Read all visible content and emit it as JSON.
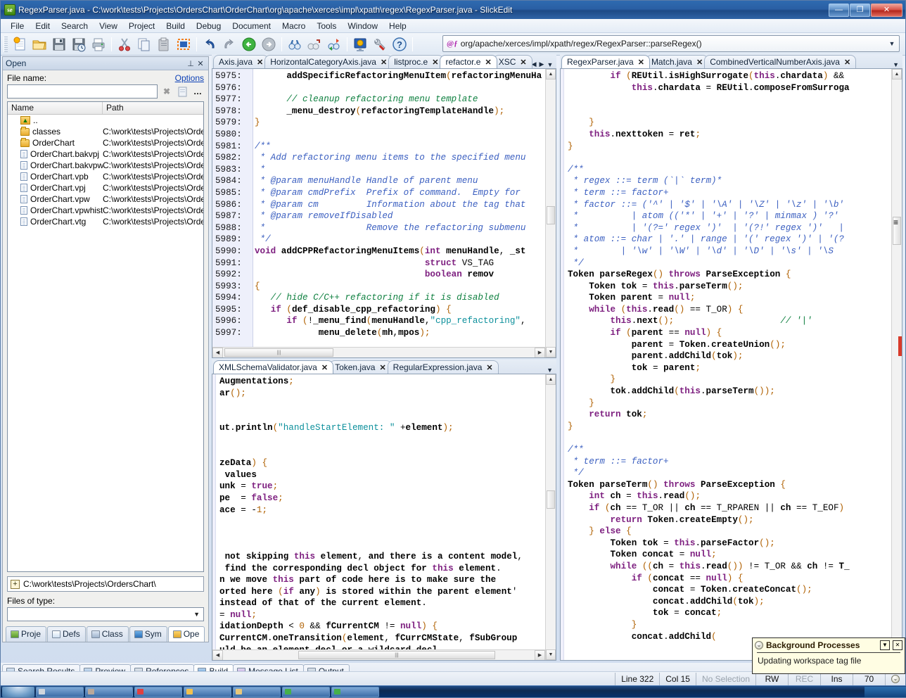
{
  "window": {
    "title": "RegexParser.java - C:\\work\\tests\\Projects\\OrdersChart\\OrderChart\\org\\apache\\xerces\\impl\\xpath\\regex\\RegexParser.java - SlickEdit",
    "app_icon": "se",
    "minimize": "—",
    "maximize": "❐",
    "close": "✕"
  },
  "menu": {
    "items": [
      "File",
      "Edit",
      "Search",
      "View",
      "Project",
      "Build",
      "Debug",
      "Document",
      "Macro",
      "Tools",
      "Window",
      "Help"
    ]
  },
  "toolbar": {
    "icons": [
      {
        "name": "new-file-icon",
        "glyph": "📄"
      },
      {
        "name": "open-folder-icon",
        "glyph": "📂"
      },
      {
        "name": "save-icon",
        "glyph": "💾"
      },
      {
        "name": "save-as-icon",
        "glyph": "💾"
      },
      {
        "name": "print-icon",
        "glyph": "🖨"
      },
      {
        "name": "cut-icon",
        "glyph": "✂"
      },
      {
        "name": "copy-icon",
        "glyph": "⧉"
      },
      {
        "name": "paste-icon",
        "glyph": "📋"
      },
      {
        "name": "select-block-icon",
        "glyph": "▣"
      },
      {
        "name": "undo-icon",
        "glyph": "↶"
      },
      {
        "name": "redo-icon",
        "glyph": "↷"
      },
      {
        "name": "back-icon",
        "glyph": "←"
      },
      {
        "name": "forward-icon",
        "glyph": "→"
      },
      {
        "name": "find-icon",
        "glyph": "👓"
      },
      {
        "name": "find-next-icon",
        "glyph": "👓"
      },
      {
        "name": "replace-icon",
        "glyph": "👓"
      },
      {
        "name": "configuration-icon",
        "glyph": "🖥"
      },
      {
        "name": "options-wrench-icon",
        "glyph": "🔧"
      },
      {
        "name": "help-icon",
        "glyph": "?"
      }
    ]
  },
  "address_bar": {
    "icon": "function-icon",
    "icon_glyph": "@ƒ",
    "value": "org/apache/xerces/impl/xpath/regex/RegexParser::parseRegex()",
    "dropdown_glyph": "▼"
  },
  "open_panel": {
    "title": "Open",
    "pin_glyph": "⊥",
    "close_glyph": "✕",
    "file_name_label": "File name:",
    "options_link": "Options",
    "file_name_value": "",
    "clear_glyph": "✖",
    "newfile_glyph": "🗋",
    "more_glyph": "…",
    "columns": [
      "Name",
      "Path"
    ],
    "rows": [
      {
        "icon": "up-folder-icon",
        "name": "..",
        "path": ""
      },
      {
        "icon": "folder-icon",
        "name": "classes",
        "path": "C:\\work\\tests\\Projects\\OrdersC"
      },
      {
        "icon": "folder-icon",
        "name": "OrderChart",
        "path": "C:\\work\\tests\\Projects\\OrdersC"
      },
      {
        "icon": "file-icon",
        "name": "OrderChart.bakvpj",
        "path": "C:\\work\\tests\\Projects\\OrdersC"
      },
      {
        "icon": "file-icon",
        "name": "OrderChart.bakvpw",
        "path": "C:\\work\\tests\\Projects\\OrdersC"
      },
      {
        "icon": "file-icon",
        "name": "OrderChart.vpb",
        "path": "C:\\work\\tests\\Projects\\OrdersC"
      },
      {
        "icon": "file-icon",
        "name": "OrderChart.vpj",
        "path": "C:\\work\\tests\\Projects\\OrdersC"
      },
      {
        "icon": "file-icon",
        "name": "OrderChart.vpw",
        "path": "C:\\work\\tests\\Projects\\OrdersC"
      },
      {
        "icon": "file-icon",
        "name": "OrderChart.vpwhist",
        "path": "C:\\work\\tests\\Projects\\OrdersC"
      },
      {
        "icon": "file-icon",
        "name": "OrderChart.vtg",
        "path": "C:\\work\\tests\\Projects\\OrdersC"
      }
    ],
    "path_value": "C:\\work\\tests\\Projects\\OrdersChart\\",
    "path_expand_glyph": "+",
    "files_of_type_label": "Files of type:",
    "files_of_type_value": "",
    "dropdown_glyph": "▼",
    "tabs": [
      {
        "label": "Proje",
        "icon": "projects-icon",
        "active": false
      },
      {
        "label": "Defs",
        "icon": "defs-icon",
        "active": false
      },
      {
        "label": "Class",
        "icon": "class-icon",
        "active": false
      },
      {
        "label": "Sym",
        "icon": "symbols-icon",
        "active": false
      },
      {
        "label": "Ope",
        "icon": "open-icon",
        "active": true
      }
    ]
  },
  "center_top_editor": {
    "tabs": [
      {
        "label": "Axis.java",
        "active": false
      },
      {
        "label": "HorizontalCategoryAxis.java",
        "active": false
      },
      {
        "label": "listproc.e",
        "active": false
      },
      {
        "label": "refactor.e",
        "active": true
      },
      {
        "label": "XSC",
        "active": false
      }
    ],
    "nav_prev": "◀",
    "nav_next": "▶",
    "nav_list": "▼",
    "first_line_number": 5975,
    "lines": [
      "5975:",
      "5976:",
      "5977:",
      "5978:",
      "5979:",
      "5980:",
      "5981:",
      "5982:",
      "5983:",
      "5984:",
      "5985:",
      "5986:",
      "5987:",
      "5988:",
      "5989:",
      "5990:",
      "5991:",
      "5992:",
      "5993:",
      "5994:",
      "5995:",
      "5996:",
      "5997:"
    ],
    "code_text": [
      "      addSpecificRefactoringMenuItem(refactoringMenuHa",
      "",
      "      // cleanup refactoring menu template",
      "      _menu_destroy(refactoringTemplateHandle);",
      "}",
      "",
      "/**",
      " * Add refactoring menu items to the specified menu",
      " *",
      " * @param menuHandle Handle of parent menu",
      " * @param cmdPrefix  Prefix of command.  Empty for ",
      " * @param cm         Information about the tag that",
      " * @param removeIfDisabled",
      " *                   Remove the refactoring submenu",
      " */",
      "void addCPPRefactoringMenuItems(int menuHandle, _st",
      "                                struct VS_TAG",
      "                                boolean remov",
      "{",
      "   // hide C/C++ refactoring if it is disabled",
      "   if (def_disable_cpp_refactoring) {",
      "      if (!_menu_find(menuHandle,\"cpp_refactoring\",",
      "            menu_delete(mh,mpos);"
    ]
  },
  "center_bottom_editor": {
    "tabs": [
      {
        "label": "XMLSchemaValidator.java",
        "active": true
      },
      {
        "label": "Token.java",
        "active": false
      },
      {
        "label": "RegularExpression.java",
        "active": false
      }
    ],
    "nav_list": "▼",
    "code_text": [
      "Augmentations;",
      "ar();",
      "",
      "",
      "ut.println(\"handleStartElement: \" +element);",
      "",
      "",
      "zeData) {",
      " values",
      "unk = true;",
      "pe  = false;",
      "ace = -1;",
      "",
      "",
      "",
      " not skipping this element, and there is a content model,",
      " find the corresponding decl object for this element.",
      "n we move this part of code here is to make sure the",
      "orted here (if any) is stored within the parent element'",
      "instead of that of the current element.",
      "= null;",
      "idationDepth < 0 && fCurrentCM != null) {",
      "CurrentCM.oneTransition(element, fCurrCMState, fSubGroup",
      "uld be an element decl or a wildcard decl"
    ]
  },
  "right_editor": {
    "tabs": [
      {
        "label": "RegexParser.java",
        "active": true
      },
      {
        "label": "Match.java",
        "active": false
      },
      {
        "label": "CombinedVerticalNumberAxis.java",
        "active": false
      }
    ],
    "nav_list": "▼",
    "code_text": [
      "        if (REUtil.isHighSurrogate(this.chardata) &&",
      "            this.chardata = REUtil.composeFromSurroga",
      "",
      "",
      "    }",
      "    this.nexttoken = ret;",
      "}",
      "",
      "/**",
      " * regex ::= term (`|` term)*",
      " * term ::= factor+",
      " * factor ::= ('^' | '$' | '\\A' | '\\Z' | '\\z' | '\\b'",
      " *          | atom (('*' | '+' | '?' | minmax ) '?'",
      " *          | '(?=' regex ')'  | '(?!' regex ')'   |",
      " * atom ::= char | '.' | range | '(' regex ')' | '(?",
      " *        | '\\w' | '\\W' | '\\d' | '\\D' | '\\s' | '\\S",
      " */",
      "Token parseRegex() throws ParseException {",
      "    Token tok = this.parseTerm();",
      "    Token parent = null;",
      "    while (this.read() == T_OR) {",
      "        this.next();                    // '|'",
      "        if (parent == null) {",
      "            parent = Token.createUnion();",
      "            parent.addChild(tok);",
      "            tok = parent;",
      "        }",
      "        tok.addChild(this.parseTerm());",
      "    }",
      "    return tok;",
      "}",
      "",
      "/**",
      " * term ::= factor+",
      " */",
      "Token parseTerm() throws ParseException {",
      "    int ch = this.read();",
      "    if (ch == T_OR || ch == T_RPAREN || ch == T_EOF)",
      "        return Token.createEmpty();",
      "    } else {",
      "        Token tok = this.parseFactor();",
      "        Token concat = null;",
      "        while ((ch = this.read()) != T_OR && ch != T_",
      "            if (concat == null) {",
      "                concat = Token.createConcat();",
      "                concat.addChild(tok);",
      "                tok = concat;",
      "            }",
      "            concat.addChild("
    ]
  },
  "bottom_tabs": [
    {
      "label": "Search Results",
      "icon": "search-results-icon",
      "active": false
    },
    {
      "label": "Preview",
      "icon": "preview-icon",
      "active": false
    },
    {
      "label": "References",
      "icon": "references-icon",
      "active": false
    },
    {
      "label": "Build",
      "icon": "build-icon",
      "active": true
    },
    {
      "label": "Message List",
      "icon": "message-list-icon",
      "active": false
    },
    {
      "label": "Output",
      "icon": "output-icon",
      "active": false
    }
  ],
  "status_bar": {
    "line": "Line 322",
    "col": "Col 15",
    "selection": "No Selection",
    "readwrite": "RW",
    "record": "REC",
    "insert": "Ins",
    "value": "70",
    "indicator_glyph": "⌄"
  },
  "background_processes": {
    "title": "Background Processes",
    "circle_glyph": "⌄",
    "dropdown_glyph": "▼",
    "close_glyph": "✕",
    "message": "Updating workspace tag file"
  },
  "taskbar": {
    "start_label": "",
    "tasks": [
      "",
      "",
      "",
      "",
      "",
      "",
      ""
    ]
  },
  "colors": {
    "title_bar": "#2a5fa4",
    "accent": "#0b3fb5",
    "comment": "#0f8040",
    "keyword": "#7e2080",
    "string": "#0b8f9b",
    "doc_comment": "#3b5fc0",
    "popup_bg": "#fffde3"
  }
}
